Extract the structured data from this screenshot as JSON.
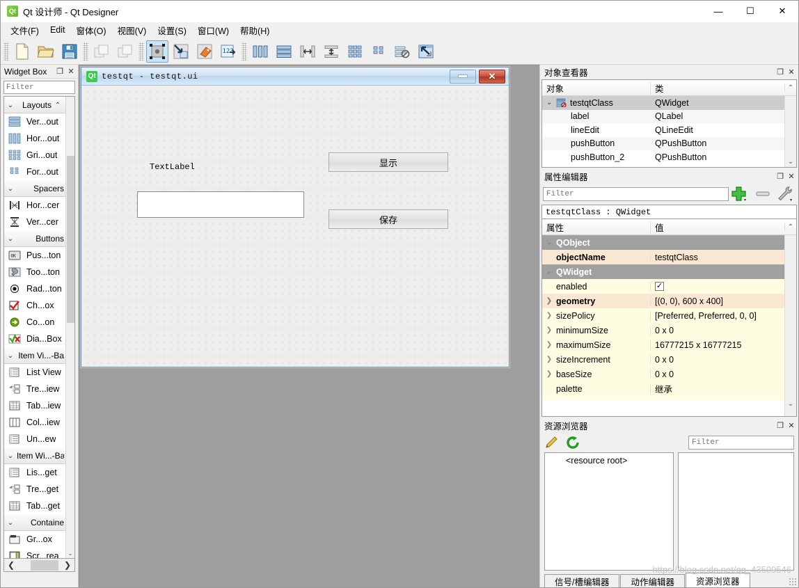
{
  "window": {
    "title": "Qt 设计师 - Qt Designer",
    "icon": "qt-logo-icon",
    "minimize": "—",
    "maximize": "☐",
    "close": "✕"
  },
  "menubar": {
    "items": [
      {
        "label": "文件(F)",
        "name": "menu-file"
      },
      {
        "label": "Edit",
        "name": "menu-edit"
      },
      {
        "label": "窗体(O)",
        "name": "menu-form"
      },
      {
        "label": "视图(V)",
        "name": "menu-view"
      },
      {
        "label": "设置(S)",
        "name": "menu-settings"
      },
      {
        "label": "窗口(W)",
        "name": "menu-window"
      },
      {
        "label": "帮助(H)",
        "name": "menu-help"
      }
    ]
  },
  "toolbar": {
    "groups": [
      [
        "new-form",
        "open-form",
        "save-form"
      ],
      [
        "undo",
        "redo"
      ],
      [
        "edit-widgets",
        "edit-signals-slots",
        "edit-buddies",
        "edit-tab-order"
      ],
      [
        "layout-horizontal",
        "layout-vertical",
        "layout-splitter-h",
        "layout-splitter-v",
        "layout-grid",
        "layout-form",
        "break-layout",
        "adjust-size"
      ]
    ]
  },
  "widget_box": {
    "title": "Widget Box",
    "float_btn": "❐",
    "close_btn": "✕",
    "filter_placeholder": "Filter",
    "categories": [
      {
        "name": "Layouts",
        "label": "Layouts",
        "items": [
          {
            "label": "Ver...out",
            "icon": "vertical-layout-icon"
          },
          {
            "label": "Hor...out",
            "icon": "horizontal-layout-icon"
          },
          {
            "label": "Gri...out",
            "icon": "grid-layout-icon"
          },
          {
            "label": "For...out",
            "icon": "form-layout-icon"
          }
        ]
      },
      {
        "name": "Spacers",
        "label": "Spacers",
        "items": [
          {
            "label": "Hor...cer",
            "icon": "horizontal-spacer-icon"
          },
          {
            "label": "Ver...cer",
            "icon": "vertical-spacer-icon"
          }
        ]
      },
      {
        "name": "Buttons",
        "label": "Buttons",
        "items": [
          {
            "label": "Pus...ton",
            "icon": "push-button-icon"
          },
          {
            "label": "Too...ton",
            "icon": "tool-button-icon"
          },
          {
            "label": "Rad...ton",
            "icon": "radio-button-icon"
          },
          {
            "label": "Ch...ox",
            "icon": "check-box-icon"
          },
          {
            "label": "Co...on",
            "icon": "command-link-button-icon"
          },
          {
            "label": "Dia...Box",
            "icon": "dialog-button-box-icon"
          }
        ]
      },
      {
        "name": "Item Views",
        "label": "Item Vi...-Ba",
        "items": [
          {
            "label": "List View",
            "icon": "list-view-icon"
          },
          {
            "label": "Tre...iew",
            "icon": "tree-view-icon"
          },
          {
            "label": "Tab...iew",
            "icon": "table-view-icon"
          },
          {
            "label": "Col...iew",
            "icon": "column-view-icon"
          },
          {
            "label": "Un...ew",
            "icon": "undo-view-icon"
          }
        ]
      },
      {
        "name": "Item Widgets",
        "label": "Item Wi...-Ba",
        "items": [
          {
            "label": "Lis...get",
            "icon": "list-widget-icon"
          },
          {
            "label": "Tre...get",
            "icon": "tree-widget-icon"
          },
          {
            "label": "Tab...get",
            "icon": "table-widget-icon"
          }
        ]
      },
      {
        "name": "Containers",
        "label": "Containe",
        "items": [
          {
            "label": "Gr...ox",
            "icon": "group-box-icon"
          },
          {
            "label": "Scr...rea",
            "icon": "scroll-area-icon"
          }
        ]
      }
    ],
    "hscroll_left": "❮",
    "hscroll_right": "❯",
    "vscroll_down": "⌄"
  },
  "form": {
    "icon": "qt-logo-icon",
    "title": "testqt - testqt.ui",
    "minimize": "minimize-icon",
    "close": "✕",
    "widgets": [
      {
        "type": "label",
        "name": "label",
        "text": "TextLabel"
      },
      {
        "type": "button",
        "name": "pushButton",
        "text": "显示"
      },
      {
        "type": "button",
        "name": "pushButton_2",
        "text": "保存"
      },
      {
        "type": "lineedit",
        "name": "lineEdit",
        "text": ""
      }
    ]
  },
  "object_inspector": {
    "title": "对象查看器",
    "float_btn": "❐",
    "close_btn": "✕",
    "columns": [
      "对象",
      "类"
    ],
    "scroll_up": "⌃",
    "scroll_down": "⌄",
    "rows": [
      {
        "object": "testqtClass",
        "class": "QWidget",
        "indent": 0,
        "selected": true,
        "expander": "⌄",
        "icon": "widget-icon"
      },
      {
        "object": "label",
        "class": "QLabel",
        "indent": 1,
        "selected": false,
        "expander": "",
        "icon": ""
      },
      {
        "object": "lineEdit",
        "class": "QLineEdit",
        "indent": 1,
        "selected": false,
        "expander": "",
        "icon": ""
      },
      {
        "object": "pushButton",
        "class": "QPushButton",
        "indent": 1,
        "selected": false,
        "expander": "",
        "icon": ""
      },
      {
        "object": "pushButton_2",
        "class": "QPushButton",
        "indent": 1,
        "selected": false,
        "expander": "",
        "icon": ""
      }
    ]
  },
  "property_editor": {
    "title": "属性编辑器",
    "float_btn": "❐",
    "close_btn": "✕",
    "filter_placeholder": "Filter",
    "buttons": [
      "add-property-icon",
      "remove-property-icon",
      "configure-icon"
    ],
    "object_line": "testqtClass : QWidget",
    "columns": [
      "属性",
      "值"
    ],
    "scroll_up": "⌃",
    "scroll_down": "⌄",
    "rows": [
      {
        "kind": "group",
        "name": "QObject",
        "value": "",
        "expander": "⌄"
      },
      {
        "kind": "override",
        "name": "objectName",
        "value": "testqtClass",
        "expander": ""
      },
      {
        "kind": "group",
        "name": "QWidget",
        "value": "",
        "expander": "⌄"
      },
      {
        "kind": "normal",
        "name": "enabled",
        "value": "",
        "expander": "",
        "checkbox": true,
        "checked": true
      },
      {
        "kind": "override",
        "name": "geometry",
        "value": "[(0, 0), 600 x 400]",
        "expander": "❯"
      },
      {
        "kind": "normal",
        "name": "sizePolicy",
        "value": "[Preferred, Preferred, 0, 0]",
        "expander": "❯"
      },
      {
        "kind": "normal",
        "name": "minimumSize",
        "value": "0 x 0",
        "expander": "❯"
      },
      {
        "kind": "normal",
        "name": "maximumSize",
        "value": "16777215 x 16777215",
        "expander": "❯"
      },
      {
        "kind": "normal",
        "name": "sizeIncrement",
        "value": "0 x 0",
        "expander": "❯"
      },
      {
        "kind": "normal",
        "name": "baseSize",
        "value": "0 x 0",
        "expander": "❯"
      },
      {
        "kind": "normal",
        "name": "palette",
        "value": "继承",
        "expander": ""
      }
    ]
  },
  "resource_browser": {
    "title": "资源浏览器",
    "float_btn": "❐",
    "close_btn": "✕",
    "edit_icon": "pencil-icon",
    "reload_icon": "reload-icon",
    "filter_placeholder": "Filter",
    "root_label": "<resource root>",
    "tabs": [
      {
        "label": "信号/槽编辑器",
        "selected": false
      },
      {
        "label": "动作编辑器",
        "selected": false
      },
      {
        "label": "资源浏览器",
        "selected": true
      }
    ]
  },
  "watermark": "https://blog.csdn.net/qq_43509546"
}
